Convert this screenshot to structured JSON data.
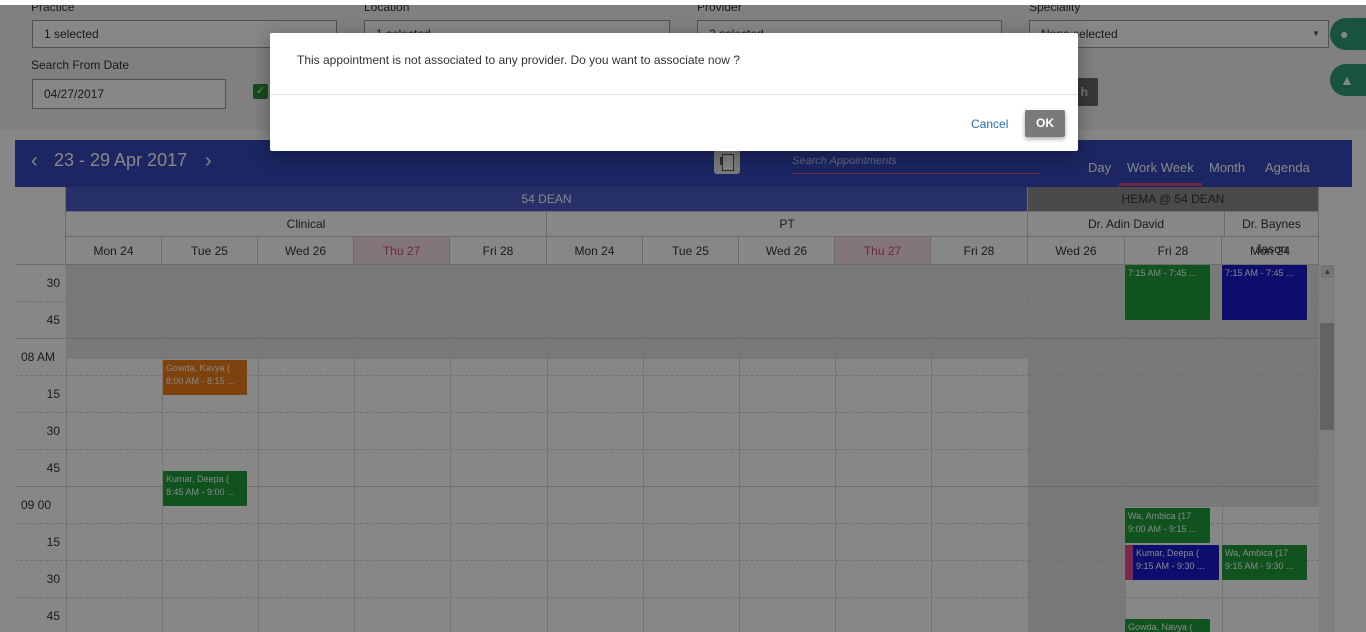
{
  "filters": {
    "practice": {
      "label": "Practice",
      "value": "1 selected"
    },
    "location": {
      "label": "Location",
      "value": "1 selected"
    },
    "provider": {
      "label": "Provider",
      "value": "2 selected"
    },
    "speciality": {
      "label": "Speciality",
      "value": "None selected"
    },
    "search_from_date": {
      "label": "Search From Date",
      "value": "04/27/2017"
    },
    "search_button": "h"
  },
  "calendar": {
    "date_range": "23 - 29 Apr 2017",
    "search_placeholder": "Search Appointments",
    "views": [
      "Day",
      "Work Week",
      "Month",
      "Agenda"
    ],
    "active_view": "Work Week",
    "resources": [
      {
        "name": "54 DEAN"
      },
      {
        "name": "HEMA @ 54 DEAN"
      }
    ],
    "groups": [
      "Clinical",
      "PT",
      "Dr. Adin David",
      "Dr. Baynes Jason"
    ],
    "days": [
      "Mon 24",
      "Tue 25",
      "Wed 26",
      "Thu 27",
      "Fri 28",
      "Mon 24",
      "Tue 25",
      "Wed 26",
      "Thu 27",
      "Fri 28",
      "Wed 26",
      "Fri 28",
      "Mon 24"
    ],
    "today_label": "Thu 27",
    "time_labels": [
      "30",
      "45",
      "08  AM",
      "15",
      "30",
      "45",
      "09   00",
      "15",
      "30",
      "45"
    ],
    "appointments": [
      {
        "line1": "7:15 AM - 7:45 ...",
        "line2": "",
        "color": "#1f9e3a"
      },
      {
        "line1": "7:15 AM - 7:45 ...",
        "line2": "",
        "color": "#1a1ad0"
      },
      {
        "line1": "Gowda, Kavya (",
        "line2": "8:00 AM - 8:15 ...",
        "color": "#ef7d18"
      },
      {
        "line1": "Kumar, Deepa (",
        "line2": "8:45 AM - 9:00 ...",
        "color": "#1f9e3a"
      },
      {
        "line1": "Wa, Ambica (17",
        "line2": "9:00 AM - 9:15 ...",
        "color": "#1f9e3a"
      },
      {
        "line1": "Kumar, Deepa (",
        "line2": "9:15 AM - 9:30 ...",
        "color": "#1a1ad0"
      },
      {
        "line1": "Wa, Ambica (17",
        "line2": "9:15 AM - 9:30 ...",
        "color": "#1f9e3a"
      },
      {
        "line1": "Gowda, Navya (",
        "line2": "",
        "color": "#1f9e3a"
      }
    ]
  },
  "dialog": {
    "message": "This appointment is not associated to any provider. Do you want to associate now ?",
    "cancel_label": "Cancel",
    "ok_label": "OK"
  }
}
